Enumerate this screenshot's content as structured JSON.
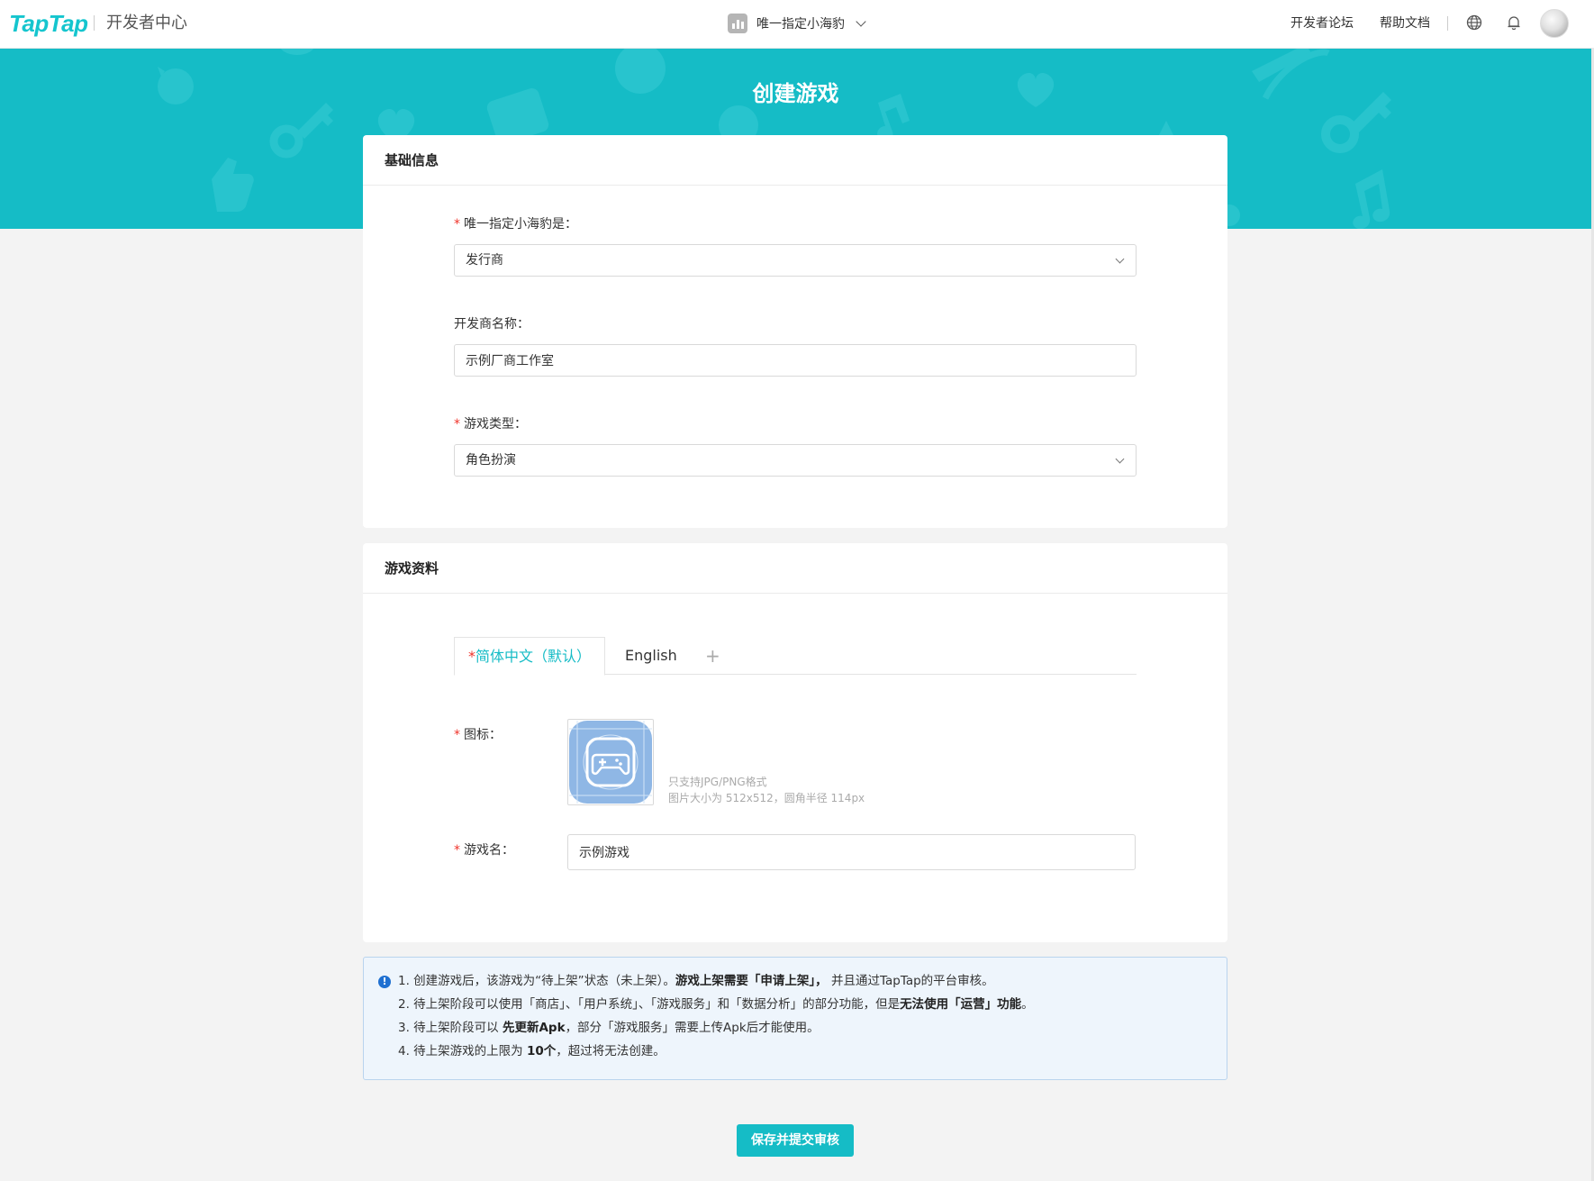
{
  "nav": {
    "logo": "TapTap",
    "subtitle": "开发者中心",
    "studio": "唯一指定小海豹",
    "forum": "开发者论坛",
    "docs": "帮助文档"
  },
  "banner": {
    "title": "创建游戏"
  },
  "basic": {
    "header": "基础信息",
    "studio_label": "唯一指定小海豹是：",
    "studio_value": "发行商",
    "dev_label": "开发商名称：",
    "dev_value": "示例厂商工作室",
    "type_label": "游戏类型：",
    "type_value": "角色扮演"
  },
  "profile": {
    "header": "游戏资料",
    "tab_default": "简体中文（默认）",
    "tab_en": "English",
    "tab_add": "+",
    "icon_label": "图标：",
    "icon_hint1": "只支持JPG/PNG格式",
    "icon_hint2": "图片大小为 512x512，圆角半径 114px",
    "name_label": "游戏名：",
    "name_value": "示例游戏"
  },
  "notice": {
    "l1a": "1. 创建游戏后，该游戏为“待上架”状态（未上架）。",
    "l1b": "游戏上架需要「申请上架」，",
    "l1c": "并且通过TapTap的平台审核。",
    "l2a": "2. 待上架阶段可以使用「商店」、「用户系统」、「游戏服务」和「数据分析」的部分功能，但是",
    "l2b": "无法使用「运营」功能",
    "l2c": "。",
    "l3a": "3. 待上架阶段可以",
    "l3b": "先更新Apk",
    "l3c": "，部分「游戏服务」需要上传Apk后才能使用。",
    "l4a": "4. 待上架游戏的上限为",
    "l4b": "10个",
    "l4c": "，超过将无法创建。"
  },
  "submit": "保存并提交审核",
  "colors": {
    "brand": "#15bcc6",
    "required": "#f0342b",
    "info": "#1f70d1"
  }
}
